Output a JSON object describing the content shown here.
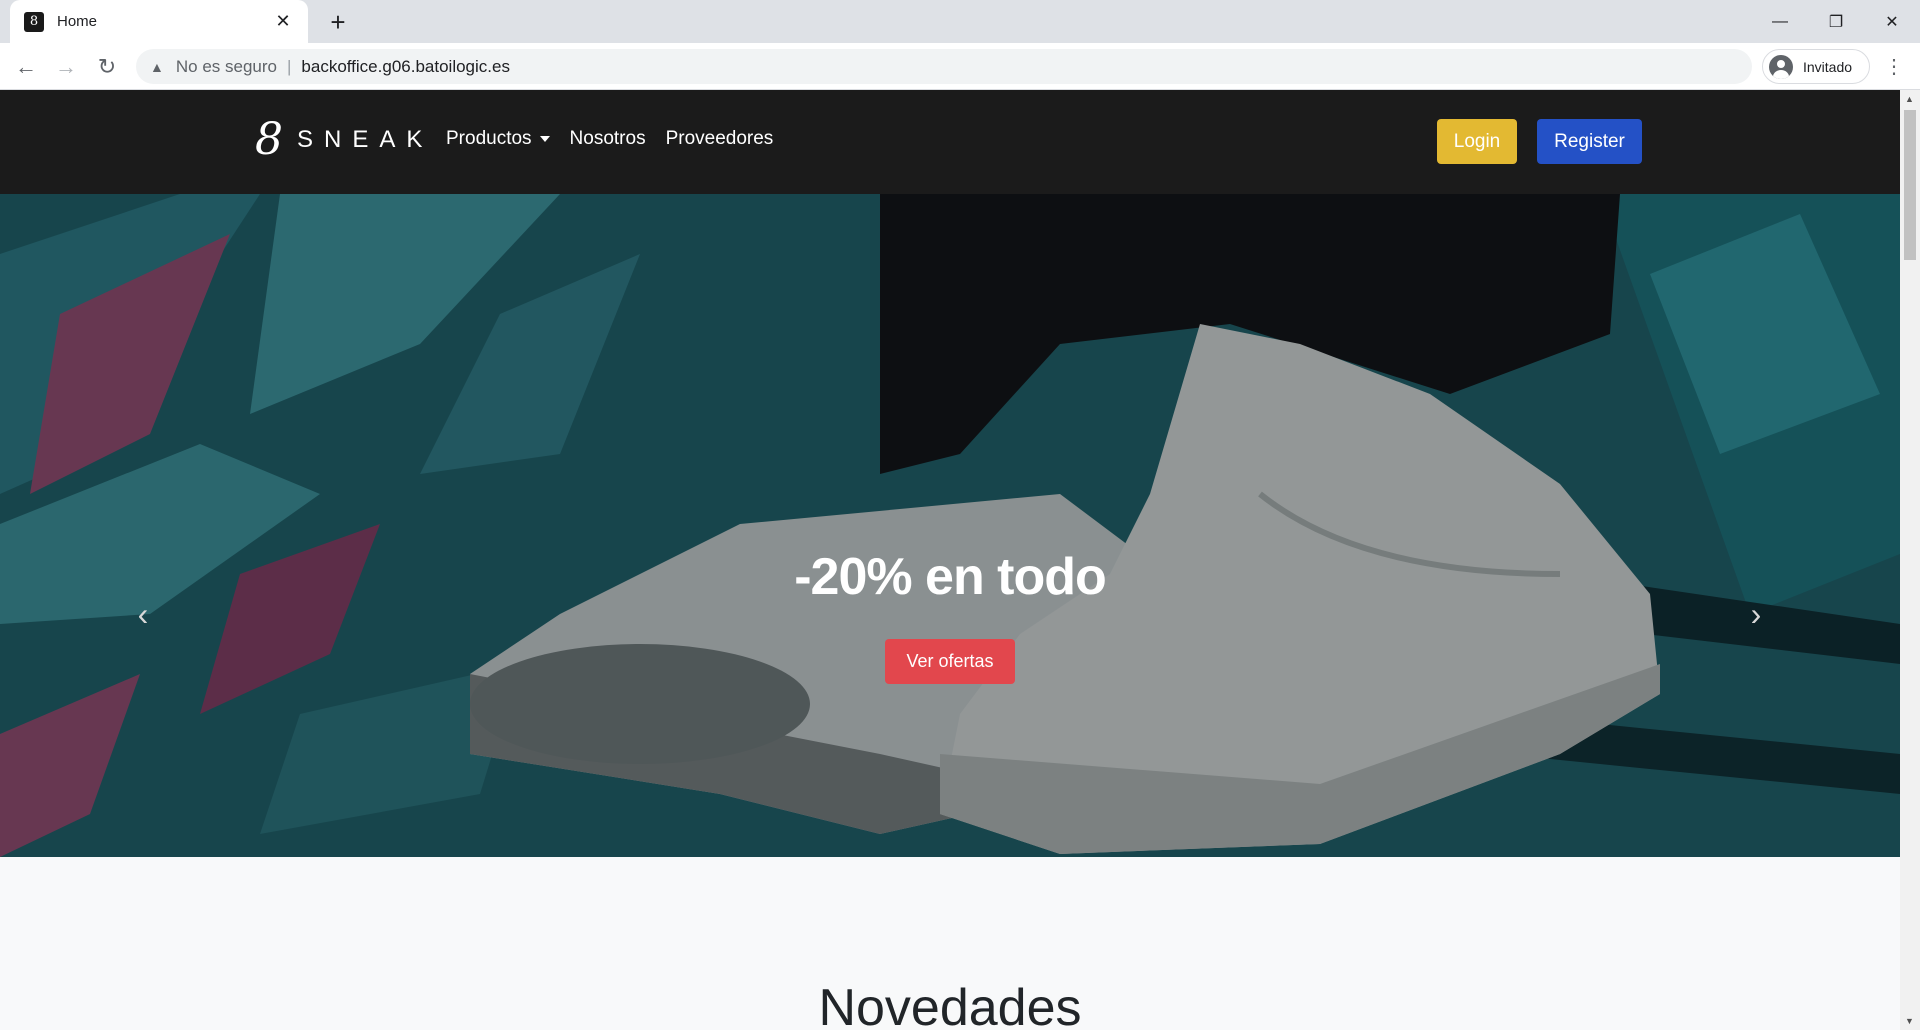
{
  "browser": {
    "tab_title": "Home",
    "favicon_glyph": "8",
    "security_label": "No es seguro",
    "url": "backoffice.g06.batoilogic.es",
    "profile_label": "Invitado"
  },
  "navbar": {
    "brand_text": "SNEAK",
    "brand_mark": "8",
    "links": [
      {
        "label": "Productos"
      },
      {
        "label": "Nosotros"
      },
      {
        "label": "Proveedores"
      }
    ],
    "login_label": "Login",
    "register_label": "Register",
    "colors": {
      "login": "#e3b932",
      "register": "#2451c6",
      "background": "#1b1b1b"
    }
  },
  "carousel": {
    "title": "-20% en todo",
    "cta_label": "Ver ofertas",
    "cta_color": "#e2474d",
    "slide_count": 2,
    "active_index": 0
  },
  "section": {
    "title": "Novedades"
  }
}
